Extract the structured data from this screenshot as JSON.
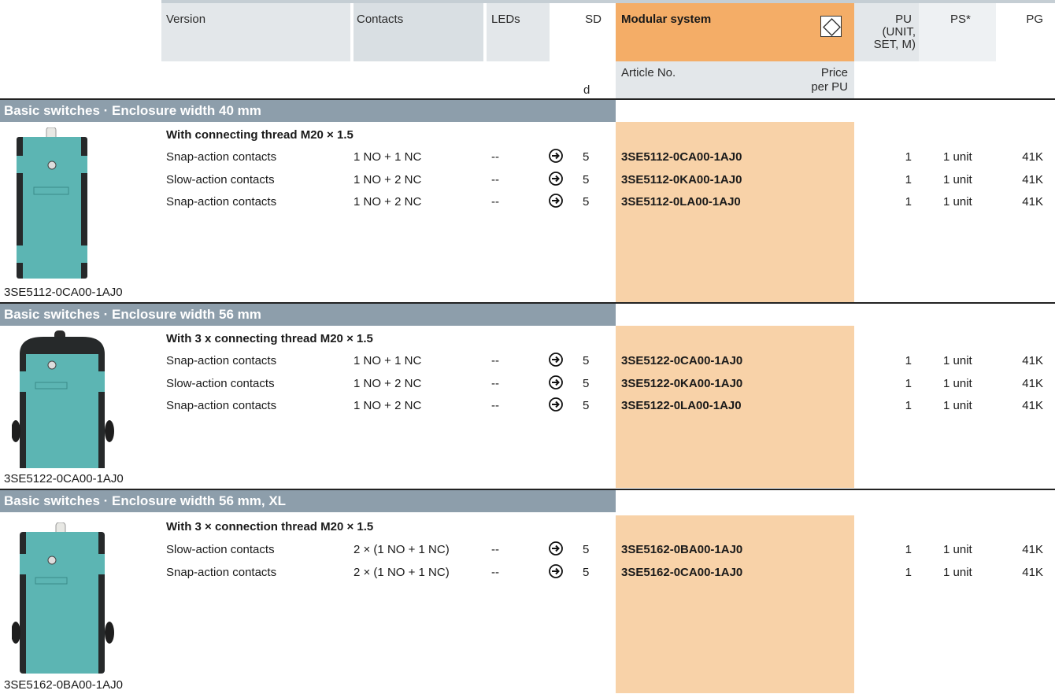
{
  "header": {
    "version": "Version",
    "contacts": "Contacts",
    "leds": "LEDs",
    "sd": "SD",
    "sd_unit": "d",
    "modular_system": "Modular system",
    "article_no": "Article No.",
    "price_line1": "Price",
    "price_line2": "per PU",
    "pu_line1": "PU",
    "pu_line2": "(UNIT,",
    "pu_line3": "SET, M)",
    "ps": "PS*",
    "pg": "PG"
  },
  "sections": [
    {
      "title": "Basic switches · Enclosure width 40 mm",
      "subtitle": "With connecting thread M20 × 1.5",
      "caption": "3SE5112-0CA00-1AJ0",
      "rows": [
        {
          "version": "Snap-action contacts",
          "contacts": "1 NO + 1 NC",
          "leds": "--",
          "sd": "5",
          "article": "3SE5112-0CA00-1AJ0",
          "pu": "1",
          "ps": "1 unit",
          "pg": "41K"
        },
        {
          "version": "Slow-action contacts",
          "contacts": "1 NO + 2 NC",
          "leds": "--",
          "sd": "5",
          "article": "3SE5112-0KA00-1AJ0",
          "pu": "1",
          "ps": "1 unit",
          "pg": "41K"
        },
        {
          "version": "Snap-action contacts",
          "contacts": "1 NO + 2 NC",
          "leds": "--",
          "sd": "5",
          "article": "3SE5112-0LA00-1AJ0",
          "pu": "1",
          "ps": "1 unit",
          "pg": "41K"
        }
      ]
    },
    {
      "title": "Basic switches · Enclosure width 56 mm",
      "subtitle": "With 3 x connecting thread M20 × 1.5",
      "caption": "3SE5122-0CA00-1AJ0",
      "rows": [
        {
          "version": "Snap-action contacts",
          "contacts": "1 NO + 1 NC",
          "leds": "--",
          "sd": "5",
          "article": "3SE5122-0CA00-1AJ0",
          "pu": "1",
          "ps": "1 unit",
          "pg": "41K"
        },
        {
          "version": "Slow-action contacts",
          "contacts": "1 NO + 2 NC",
          "leds": "--",
          "sd": "5",
          "article": "3SE5122-0KA00-1AJ0",
          "pu": "1",
          "ps": "1 unit",
          "pg": "41K"
        },
        {
          "version": "Snap-action contacts",
          "contacts": "1 NO + 2 NC",
          "leds": "--",
          "sd": "5",
          "article": "3SE5122-0LA00-1AJ0",
          "pu": "1",
          "ps": "1 unit",
          "pg": "41K"
        }
      ]
    },
    {
      "title": "Basic switches · Enclosure width 56 mm, XL",
      "subtitle": "With 3 × connection thread M20 × 1.5",
      "caption": "3SE5162-0BA00-1AJ0",
      "rows": [
        {
          "version": "Slow-action contacts",
          "contacts": "2 × (1 NO + 1 NC)",
          "leds": "--",
          "sd": "5",
          "article": "3SE5162-0BA00-1AJ0",
          "pu": "1",
          "ps": "1 unit",
          "pg": "41K"
        },
        {
          "version": "Snap-action contacts",
          "contacts": "2 × (1 NO + 1 NC)",
          "leds": "--",
          "sd": "5",
          "article": "3SE5162-0CA00-1AJ0",
          "pu": "1",
          "ps": "1 unit",
          "pg": "41K"
        }
      ]
    }
  ],
  "icons": {
    "delivery_arrow": "circled-right-arrow-icon",
    "modular": "diamond-in-square-icon"
  },
  "colors": {
    "section_bar": "#8d9eab",
    "modular_header": "#f4ad67",
    "article_column": "#f8d2a8",
    "product_teal": "#5cb5b3"
  }
}
